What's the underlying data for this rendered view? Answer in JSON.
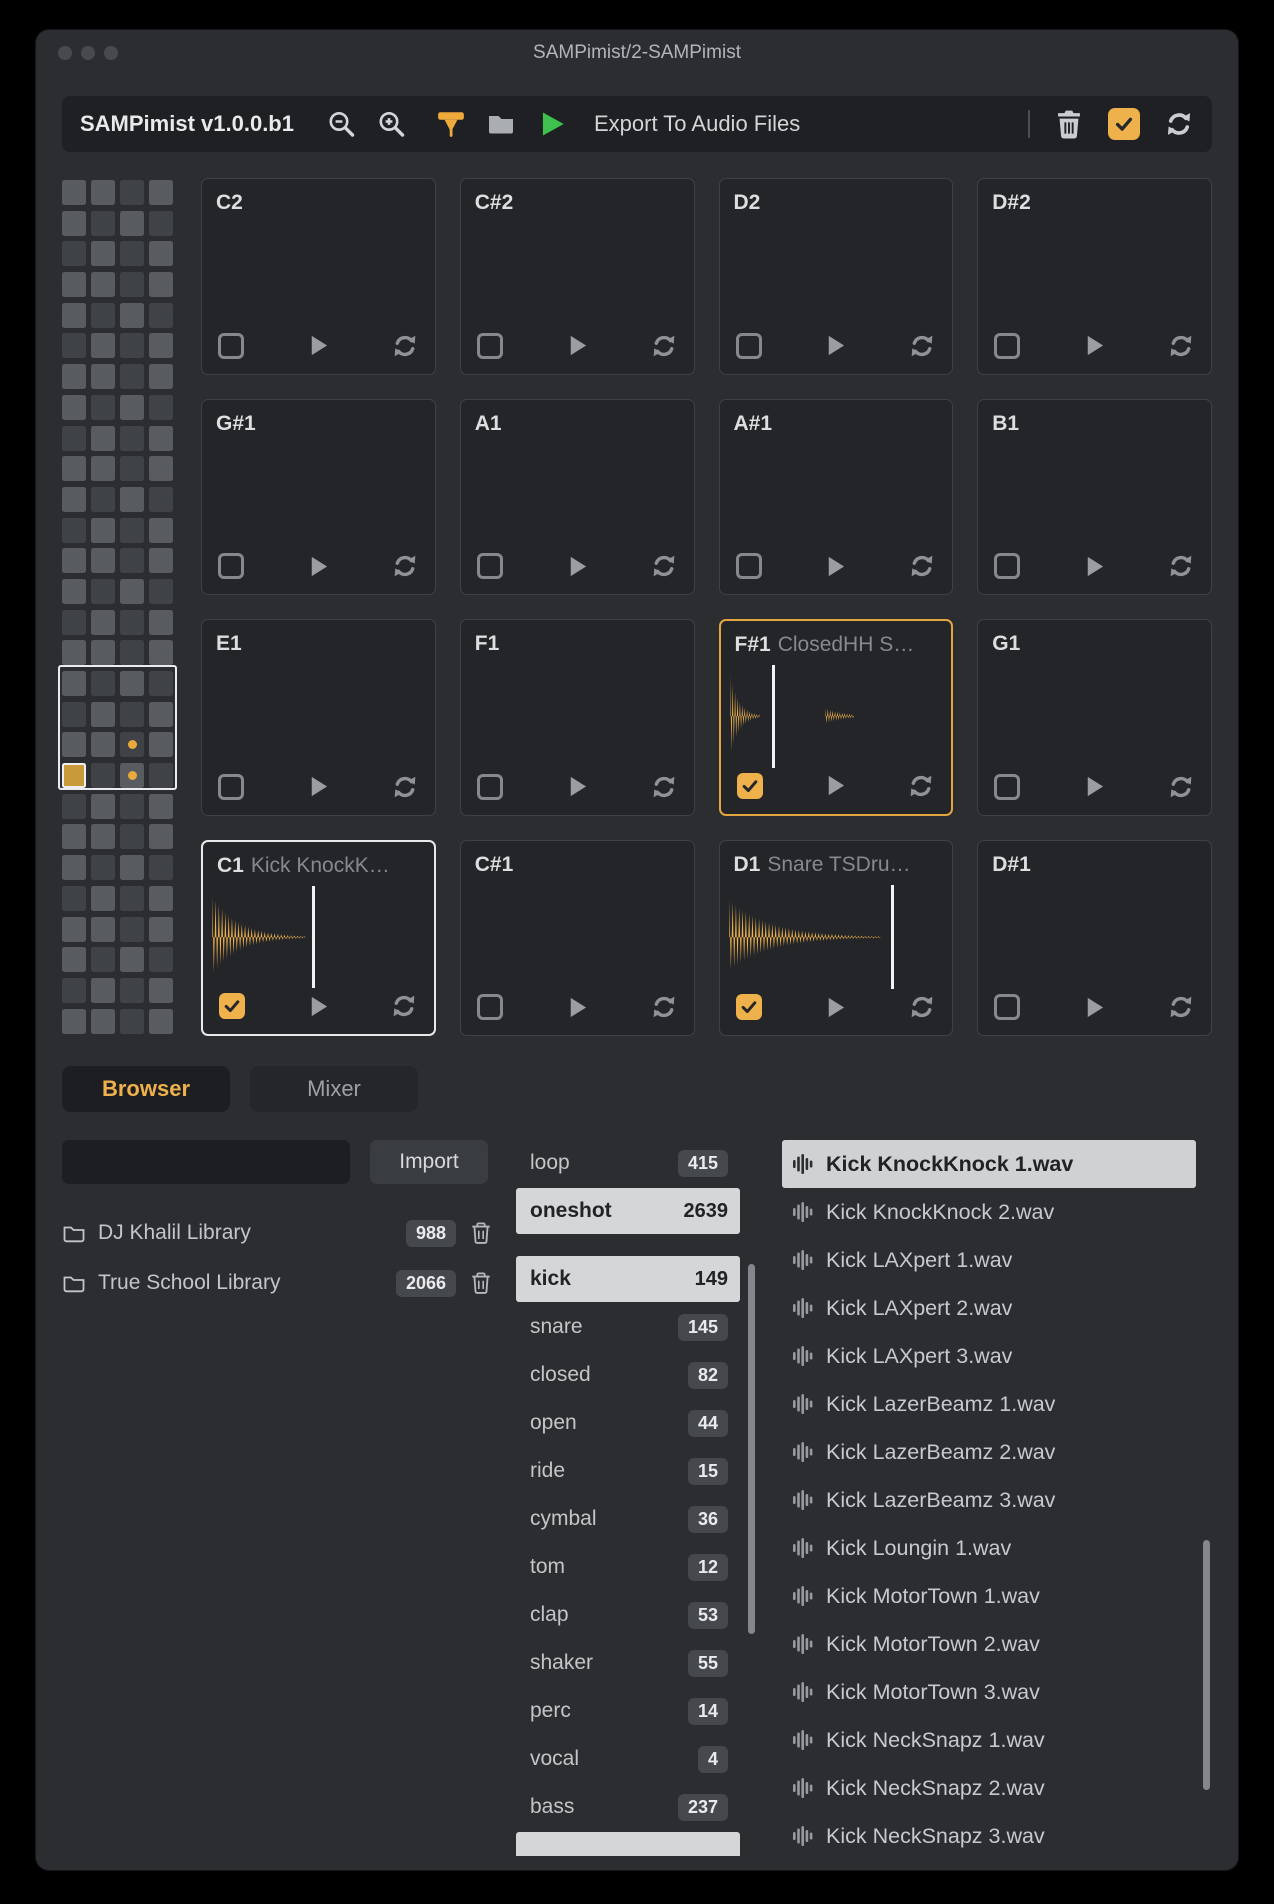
{
  "window": {
    "title": "SAMPimist/2-SAMPimist"
  },
  "toolbar": {
    "app_version": "SAMPimist v1.0.0.b1",
    "export_label": "Export To Audio Files"
  },
  "colors": {
    "accent": "#eeb14b",
    "wave": "#edb04a",
    "green": "#3ec24d",
    "selected_row_bg": "#d5d6d8"
  },
  "icons": {
    "zoom_out": "magnifier-minus",
    "zoom_in": "magnifier-plus",
    "marker": "orange-flag",
    "folder": "folder",
    "play": "green-triangle",
    "trash": "trash-can",
    "select_all": "checked-box",
    "reload": "circular-arrows",
    "waveform": "vertical-bars",
    "check": "checkmark"
  },
  "pads": [
    {
      "note": "C2"
    },
    {
      "note": "C#2"
    },
    {
      "note": "D2"
    },
    {
      "note": "D#2"
    },
    {
      "note": "G#1"
    },
    {
      "note": "A1"
    },
    {
      "note": "A#1"
    },
    {
      "note": "B1"
    },
    {
      "note": "E1"
    },
    {
      "note": "F1"
    },
    {
      "note": "F#1",
      "sample": "ClosedHH S…",
      "checked": true,
      "selected": "orange",
      "wave": "hh",
      "playhead": 0.21
    },
    {
      "note": "G1"
    },
    {
      "note": "C1",
      "sample": "Kick KnockK…",
      "checked": true,
      "selected": "white",
      "wave": "kick",
      "playhead": 0.47
    },
    {
      "note": "C#1"
    },
    {
      "note": "D1",
      "sample": "Snare TSDru…",
      "checked": true,
      "selected": null,
      "wave": "snare",
      "playhead": 0.75
    },
    {
      "note": "D#1"
    }
  ],
  "minimap": {
    "rows": 28,
    "cols": 4,
    "box": {
      "row_start": 16,
      "row_count": 4
    },
    "dots": [
      {
        "row": 18,
        "col": 2
      },
      {
        "row": 19,
        "col": 2
      }
    ],
    "selected_cell": {
      "row": 19,
      "col": 0
    }
  },
  "tabs": {
    "browser": "Browser",
    "mixer": "Mixer"
  },
  "browser": {
    "search_value": "",
    "import_label": "Import",
    "libraries": [
      {
        "name": "DJ Khalil Library",
        "count": "988"
      },
      {
        "name": "True School Library",
        "count": "2066"
      }
    ],
    "type_filters": [
      {
        "label": "loop",
        "count": "415",
        "selected": false
      },
      {
        "label": "oneshot",
        "count": "2639",
        "selected": true
      }
    ],
    "categories": [
      {
        "label": "kick",
        "count": "149",
        "selected": true
      },
      {
        "label": "snare",
        "count": "145",
        "selected": false
      },
      {
        "label": "closed",
        "count": "82",
        "selected": false
      },
      {
        "label": "open",
        "count": "44",
        "selected": false
      },
      {
        "label": "ride",
        "count": "15",
        "selected": false
      },
      {
        "label": "cymbal",
        "count": "36",
        "selected": false
      },
      {
        "label": "tom",
        "count": "12",
        "selected": false
      },
      {
        "label": "clap",
        "count": "53",
        "selected": false
      },
      {
        "label": "shaker",
        "count": "55",
        "selected": false
      },
      {
        "label": "perc",
        "count": "14",
        "selected": false
      },
      {
        "label": "vocal",
        "count": "4",
        "selected": false
      },
      {
        "label": "bass",
        "count": "237",
        "selected": false
      }
    ],
    "files": [
      {
        "name": "Kick KnockKnock 1.wav",
        "selected": true
      },
      {
        "name": "Kick KnockKnock 2.wav",
        "selected": false
      },
      {
        "name": "Kick LAXpert 1.wav",
        "selected": false
      },
      {
        "name": "Kick LAXpert 2.wav",
        "selected": false
      },
      {
        "name": "Kick LAXpert 3.wav",
        "selected": false
      },
      {
        "name": "Kick LazerBeamz 1.wav",
        "selected": false
      },
      {
        "name": "Kick LazerBeamz 2.wav",
        "selected": false
      },
      {
        "name": "Kick LazerBeamz 3.wav",
        "selected": false
      },
      {
        "name": "Kick Loungin 1.wav",
        "selected": false
      },
      {
        "name": "Kick MotorTown 1.wav",
        "selected": false
      },
      {
        "name": "Kick MotorTown 2.wav",
        "selected": false
      },
      {
        "name": "Kick MotorTown 3.wav",
        "selected": false
      },
      {
        "name": "Kick NeckSnapz 1.wav",
        "selected": false
      },
      {
        "name": "Kick NeckSnapz 2.wav",
        "selected": false
      },
      {
        "name": "Kick NeckSnapz 3.wav",
        "selected": false
      }
    ]
  }
}
